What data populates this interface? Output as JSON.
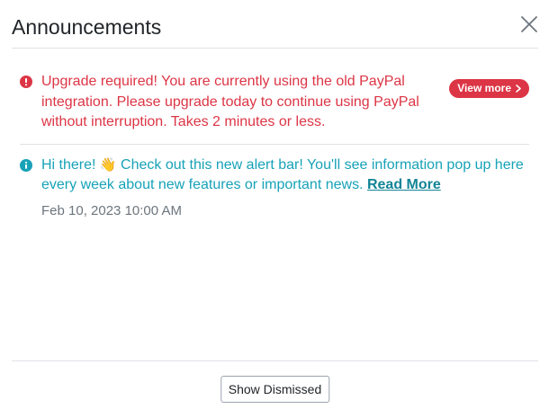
{
  "header": {
    "title": "Announcements"
  },
  "alerts": [
    {
      "type": "danger",
      "text": "Upgrade required! You are currently using the old PayPal integration. Please upgrade today to continue using PayPal without interruption. Takes 2 minutes or less.",
      "button_label": "View more",
      "color": "#dc3545"
    },
    {
      "type": "info",
      "text_before": "Hi there! ",
      "emoji": "👋",
      "text_after": " Check out this new alert bar! You'll see information pop up here every week about new features or important news. ",
      "link_label": "Read More",
      "timestamp": "Feb 10, 2023 10:00 AM",
      "color": "#17a2b8"
    }
  ],
  "footer": {
    "show_dismissed_label": "Show Dismissed"
  }
}
